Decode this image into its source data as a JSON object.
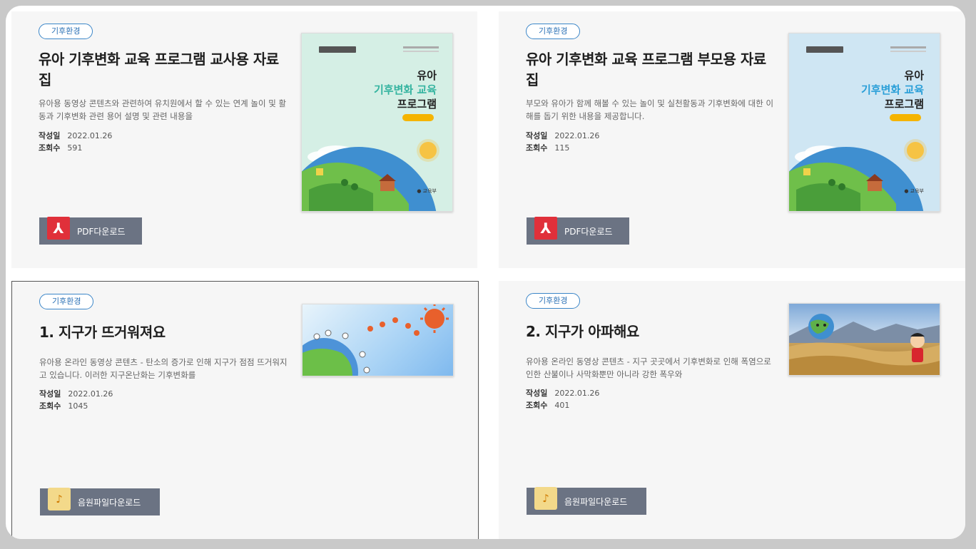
{
  "cards": [
    {
      "tag": "기후환경",
      "title": "유아 기후변화 교육 프로그램 교사용 자료집",
      "description": "유아용 동영상 콘텐츠와 관련하여 유치원에서 할 수 있는 연계 놀이 및 활동과 기후변화 관련 용어 설명 및 관련 내용을",
      "date_label": "작성일",
      "date": "2022.01.26",
      "views_label": "조회수",
      "views": "591",
      "button_label": "PDF다운로드",
      "button_icon": "pdf-icon",
      "cover": {
        "line1": "유아",
        "line2": "기후변화 교육",
        "line3": "프로그램",
        "line2_color": "#35b4a0",
        "bg": "#d5efe5"
      }
    },
    {
      "tag": "기후환경",
      "title": "유아 기후변화 교육 프로그램 부모용 자료집",
      "description": "부모와 유아가 함께 해볼 수 있는 놀이 및 실천활동과 기후변화에 대한 이해를 돕기 위한 내용을 제공합니다.",
      "date_label": "작성일",
      "date": "2022.01.26",
      "views_label": "조회수",
      "views": "115",
      "button_label": "PDF다운로드",
      "button_icon": "pdf-icon",
      "cover": {
        "line1": "유아",
        "line2": "기후변화 교육",
        "line3": "프로그램",
        "line2_color": "#2a9fd8",
        "bg": "#cfe6f3"
      }
    },
    {
      "tag": "기후환경",
      "title": "1. 지구가 뜨거워져요",
      "description": "유아용 온라인 동영상 콘텐츠 - 탄소의 증가로 인해 지구가 점점 뜨거워지고 있습니다. 이러한 지구온난화는 기후변화를",
      "date_label": "작성일",
      "date": "2022.01.26",
      "views_label": "조회수",
      "views": "1045",
      "button_label": "음원파일다운로드",
      "button_icon": "audio-file-icon"
    },
    {
      "tag": "기후환경",
      "title": "2. 지구가 아파해요",
      "description": "유아용 온라인 동영상 콘텐츠 - 지구 곳곳에서 기후변화로 인해 폭염으로 인한 산불이나 사막화뿐만 아니라 강한 폭우와",
      "date_label": "작성일",
      "date": "2022.01.26",
      "views_label": "조회수",
      "views": "401",
      "button_label": "음원파일다운로드",
      "button_icon": "audio-file-icon"
    }
  ],
  "colors": {
    "tag_border": "#3b86c8",
    "button_bg": "#6b7383",
    "pdf_red": "#e0303a",
    "card_bg": "#f6f6f6"
  }
}
